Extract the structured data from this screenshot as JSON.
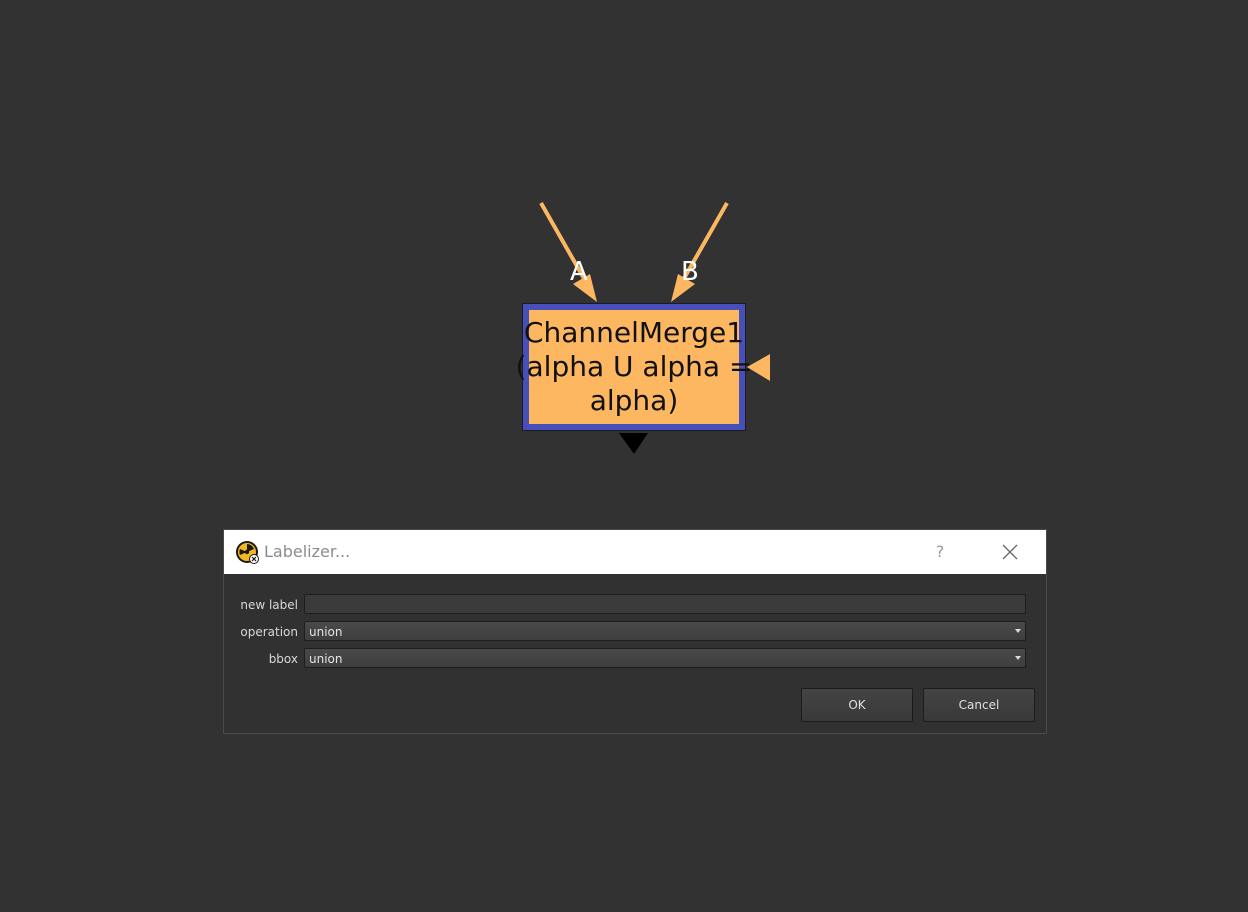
{
  "node_graph": {
    "node": {
      "name": "ChannelMerge1",
      "label_line2": "(alpha U alpha =",
      "label_line3": "alpha)",
      "colors": {
        "tile": "#fdb761",
        "selected_border": "#4750b8",
        "arrow": "#fdb761"
      }
    },
    "inputs": [
      {
        "label": "A"
      },
      {
        "label": "B"
      }
    ]
  },
  "dialog": {
    "title": "Labelizer...",
    "help_label": "?",
    "icons": {
      "app": "nuke-app-icon",
      "help": "help-icon",
      "close": "close-icon"
    },
    "fields": {
      "new_label": {
        "label": "new label",
        "value": ""
      },
      "operation": {
        "label": "operation",
        "value": "union"
      },
      "bbox": {
        "label": "bbox",
        "value": "union"
      }
    },
    "buttons": {
      "ok": "OK",
      "cancel": "Cancel"
    }
  }
}
